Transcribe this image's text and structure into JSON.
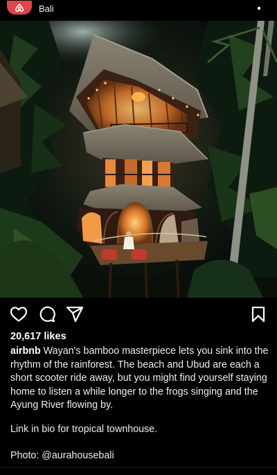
{
  "post": {
    "location": "Bali",
    "likes": "20,617 likes",
    "username": "airbnb",
    "caption": "Wayan's bamboo masterpiece lets you sink into the rhythm of the rainforest. The beach and Ubud are each a short scooter ride away, but you might find yourself staying home to listen a while longer to the frogs singing and the Ayung River flowing by.",
    "link_note": "Link in bio for tropical townhouse.",
    "photo_credit": "Photo: @aurahousebali"
  },
  "icons": {
    "avatar": "airbnb-logo-icon",
    "more": "more-options-icon",
    "like": "heart-icon",
    "comment": "comment-icon",
    "share": "send-icon",
    "save": "bookmark-icon"
  },
  "colors": {
    "brand": "#e0454b",
    "background": "#000000",
    "text": "#ffffff"
  }
}
